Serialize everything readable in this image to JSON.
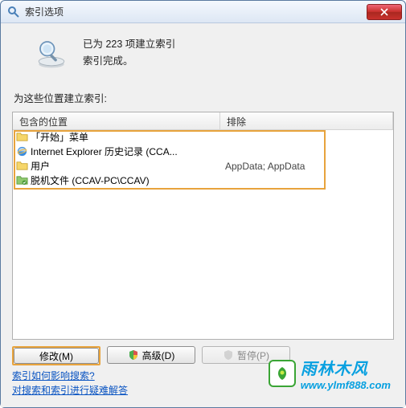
{
  "window": {
    "title": "索引选项"
  },
  "status": {
    "line1": "已为 223 项建立索引",
    "line2": "索引完成。"
  },
  "section_label": "为这些位置建立索引:",
  "columns": {
    "included": "包含的位置",
    "excluded": "排除"
  },
  "items": [
    {
      "icon": "folder",
      "label": "「开始」菜单",
      "exclude": ""
    },
    {
      "icon": "ie",
      "label": "Internet Explorer 历史记录 (CCA...",
      "exclude": ""
    },
    {
      "icon": "folder",
      "label": "用户",
      "exclude": "AppData; AppData"
    },
    {
      "icon": "offline",
      "label": "脱机文件 (CCAV-PC\\CCAV)",
      "exclude": ""
    }
  ],
  "buttons": {
    "modify": "修改(M)",
    "advanced": "高级(D)",
    "pause": "暂停(P)"
  },
  "links": {
    "l1": "索引如何影响搜索?",
    "l2": "对搜索和索引进行疑难解答"
  },
  "watermark": {
    "cn": "雨林木风",
    "url": "www.ylmf888.com"
  }
}
